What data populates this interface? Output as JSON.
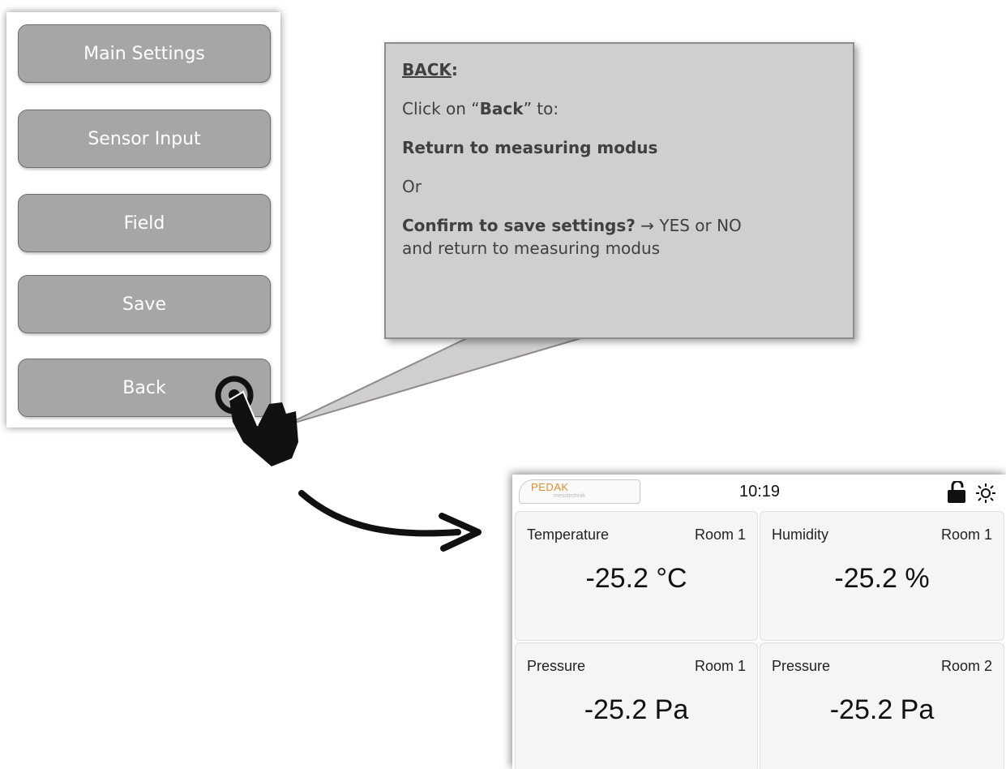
{
  "menu": {
    "buttons": [
      {
        "label": "Main Settings"
      },
      {
        "label": "Sensor Input"
      },
      {
        "label": "Field"
      },
      {
        "label": "Save"
      },
      {
        "label": "Back"
      }
    ]
  },
  "callout": {
    "title": "BACK",
    "title_colon": ":",
    "line1_pre": "Click on “",
    "line1_bold": "Back",
    "line1_post": "” to:",
    "line2": "Return to measuring modus",
    "line3": "Or",
    "line4_bold": "Confirm to save settings?",
    "line4_arrow": " → ",
    "line4_rest": "YES or NO",
    "line5": "and return to measuring modus"
  },
  "device": {
    "logo_text": "PEDAK",
    "logo_subtext": "messtechnik",
    "time": "10:19",
    "icons": [
      "lock-open-icon",
      "brightness-icon"
    ],
    "tiles": [
      {
        "name": "Temperature",
        "room": "Room 1",
        "value": "-25.2 °C"
      },
      {
        "name": "Humidity",
        "room": "Room 1",
        "value": "-25.2 %"
      },
      {
        "name": "Pressure",
        "room": "Room 1",
        "value": "-25.2 Pa"
      },
      {
        "name": "Pressure",
        "room": "Room 2",
        "value": "-25.2 Pa"
      }
    ]
  },
  "colors": {
    "button_fill": "#a6a6a6",
    "callout_fill": "#d0cece",
    "logo_accent": "#e58c2c"
  }
}
